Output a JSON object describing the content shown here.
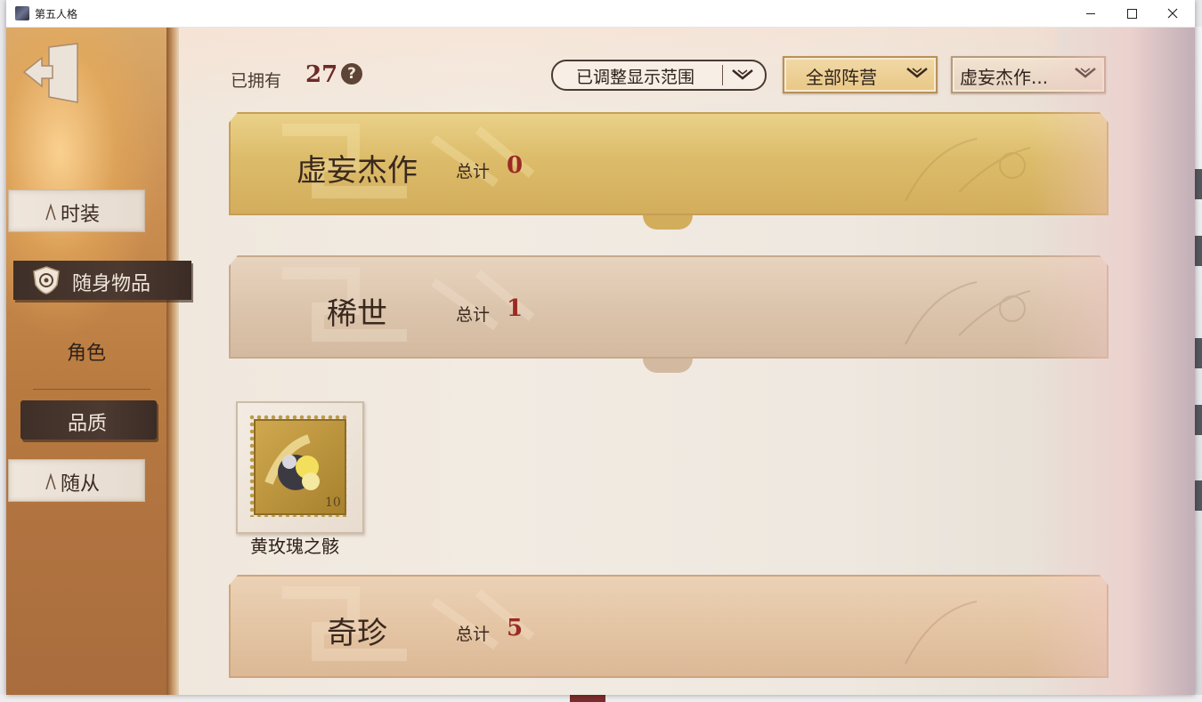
{
  "window": {
    "title": "第五人格"
  },
  "sidebar": {
    "items": [
      {
        "label": "时装"
      },
      {
        "label": "随身物品"
      },
      {
        "label": "角色"
      },
      {
        "label": "品质"
      },
      {
        "label": "随从"
      }
    ]
  },
  "header": {
    "owned_label": "已拥有",
    "owned_count": "27",
    "help_glyph": "?",
    "range_filter": "已调整显示范围",
    "faction_filter": "全部阵营",
    "rarity_filter": "虚妄杰作..."
  },
  "sections": [
    {
      "title": "虚妄杰作",
      "total_label": "总计",
      "total": "0"
    },
    {
      "title": "稀世",
      "total_label": "总计",
      "total": "1"
    },
    {
      "title": "奇珍",
      "total_label": "总计",
      "total": "5"
    }
  ],
  "items": [
    {
      "name": "黄玫瑰之骸"
    }
  ],
  "colors": {
    "accent_red": "#9b2a24",
    "dark_brown": "#3e2f28",
    "gold": "#dcbc6a"
  }
}
